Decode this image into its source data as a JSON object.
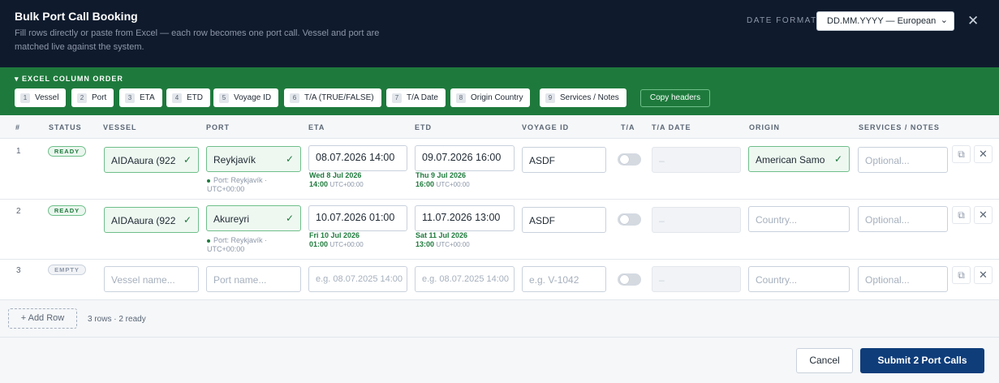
{
  "header": {
    "title": "Bulk Port Call Booking",
    "subtitle": "Fill rows directly or paste from Excel — each row becomes one port call. Vessel and port are matched live against the system.",
    "date_format_label": "DATE FORMAT",
    "date_format_value": "DD.MM.YYYY — European",
    "close_icon": "close-icon"
  },
  "column_order": {
    "label": "EXCEL COLUMN ORDER",
    "chips": [
      {
        "num": "1",
        "label": "Vessel"
      },
      {
        "num": "2",
        "label": "Port"
      },
      {
        "num": "3",
        "label": "ETA"
      },
      {
        "num": "4",
        "label": "ETD"
      },
      {
        "num": "5",
        "label": "Voyage ID"
      },
      {
        "num": "6",
        "label": "T/A (TRUE/FALSE)"
      },
      {
        "num": "7",
        "label": "T/A Date"
      },
      {
        "num": "8",
        "label": "Origin Country"
      },
      {
        "num": "9",
        "label": "Services / Notes"
      }
    ],
    "copy_headers": "Copy headers"
  },
  "table": {
    "headers": {
      "num": "#",
      "status": "STATUS",
      "vessel": "VESSEL",
      "port": "PORT",
      "eta": "ETA",
      "etd": "ETD",
      "voyage": "VOYAGE ID",
      "ta": "T/A",
      "ta_date": "T/A DATE",
      "origin": "ORIGIN",
      "services": "SERVICES / NOTES"
    },
    "rows": [
      {
        "num": "1",
        "status": "READY",
        "vessel": "AIDAaura (922",
        "port": "Reykjavík",
        "port_hint_1": "Port: Reykjavík ·",
        "port_hint_2": "UTC+00:00",
        "eta": "08.07.2026 14:00",
        "eta_hint_1": "Wed 8 Jul 2026",
        "eta_hint_2": "14:00",
        "eta_tz": "UTC+00:00",
        "etd": "09.07.2026 16:00",
        "etd_hint_1": "Thu 9 Jul 2026",
        "etd_hint_2": "16:00",
        "etd_tz": "UTC+00:00",
        "voyage": "ASDF",
        "ta_date": "–",
        "origin": "American Samo",
        "services_placeholder": "Optional..."
      },
      {
        "num": "2",
        "status": "READY",
        "vessel": "AIDAaura (922",
        "port": "Akureyri",
        "port_hint_1": "Port: Reykjavík ·",
        "port_hint_2": "UTC+00:00",
        "eta": "10.07.2026 01:00",
        "eta_hint_1": "Fri 10 Jul 2026",
        "eta_hint_2": "01:00",
        "eta_tz": "UTC+00:00",
        "etd": "11.07.2026 13:00",
        "etd_hint_1": "Sat 11 Jul 2026",
        "etd_hint_2": "13:00",
        "etd_tz": "UTC+00:00",
        "voyage": "ASDF",
        "ta_date": "–",
        "origin_placeholder": "Country...",
        "services_placeholder": "Optional..."
      },
      {
        "num": "3",
        "status": "EMPTY",
        "vessel_placeholder": "Vessel name...",
        "port_placeholder": "Port name...",
        "eta_placeholder": "e.g. 08.07.2025 14:00",
        "etd_placeholder": "e.g. 08.07.2025 14:00",
        "voyage_placeholder": "e.g. V-1042",
        "ta_date": "–",
        "origin_placeholder": "Country...",
        "services_placeholder": "Optional..."
      }
    ]
  },
  "footer": {
    "add_row": "+ Add Row",
    "row_count": "3 rows · 2 ready",
    "cancel": "Cancel",
    "submit": "Submit 2 Port Calls"
  },
  "icons": {
    "check": "check-icon",
    "copy_row": "copy-row-icon",
    "delete_row": "delete-row-icon"
  },
  "colors": {
    "header_bg": "#0f1b2d",
    "green_bar": "#1e7a3c",
    "submit_bg": "#0f3d7a",
    "ok_border": "#6fbf8a"
  }
}
